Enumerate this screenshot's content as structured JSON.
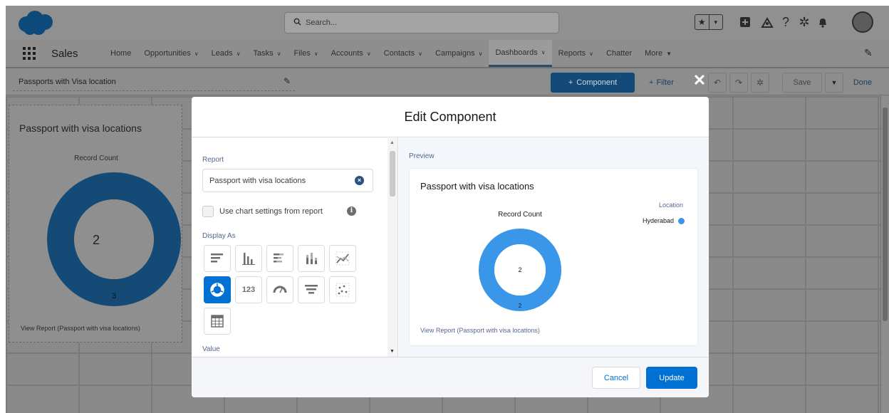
{
  "colors": {
    "brand": "#0070d2",
    "donut": "#3a96e8",
    "overlay_donut": "#164a76",
    "legend_dot": "#3a96e8"
  },
  "header": {
    "search_placeholder": "Search...",
    "icons": [
      "favorites-star-icon",
      "favorites-list-icon",
      "global-actions-icon",
      "trailhead-icon",
      "help-icon",
      "setup-gear-icon",
      "notifications-bell-icon"
    ]
  },
  "nav": {
    "app_name": "Sales",
    "items": [
      {
        "label": "Home",
        "chevron": false
      },
      {
        "label": "Opportunities",
        "chevron": true
      },
      {
        "label": "Leads",
        "chevron": true
      },
      {
        "label": "Tasks",
        "chevron": true
      },
      {
        "label": "Files",
        "chevron": true
      },
      {
        "label": "Accounts",
        "chevron": true
      },
      {
        "label": "Contacts",
        "chevron": true
      },
      {
        "label": "Campaigns",
        "chevron": true
      },
      {
        "label": "Dashboards",
        "chevron": true,
        "active": true
      },
      {
        "label": "Reports",
        "chevron": true
      },
      {
        "label": "Chatter",
        "chevron": false
      },
      {
        "label": "More",
        "chevron": true
      }
    ]
  },
  "toolbar": {
    "dashboard_title": "Passports with Visa location",
    "component_label": "Component",
    "filter_label": "Filter",
    "save_label": "Save",
    "done_label": "Done"
  },
  "background_widget": {
    "title": "Passport with visa locations",
    "record_count_label": "Record Count",
    "center_value": "2",
    "segment_value": "3",
    "view_report_link": "View Report (Passport with visa locations)"
  },
  "modal": {
    "title": "Edit Component",
    "report_label": "Report",
    "report_value": "Passport with visa locations",
    "use_chart_settings_label": "Use chart settings from report",
    "use_chart_settings_checked": false,
    "display_as_label": "Display As",
    "chart_types": [
      {
        "icon": "horizontal-bar-icon",
        "active": false
      },
      {
        "icon": "vertical-bar-icon",
        "active": false
      },
      {
        "icon": "stacked-horizontal-bar-icon",
        "active": false
      },
      {
        "icon": "stacked-vertical-bar-icon",
        "active": false
      },
      {
        "icon": "line-chart-icon",
        "active": false
      },
      {
        "icon": "donut-icon",
        "active": true
      },
      {
        "icon": "metric-icon",
        "label": "123",
        "active": false
      },
      {
        "icon": "gauge-icon",
        "active": false
      },
      {
        "icon": "funnel-icon",
        "active": false
      },
      {
        "icon": "scatter-icon",
        "active": false
      },
      {
        "icon": "table-icon",
        "active": false
      }
    ],
    "value_label": "Value",
    "preview_label": "Preview",
    "preview": {
      "title": "Passport with visa locations",
      "record_count_label": "Record Count",
      "legend_title": "Location",
      "legend_item": "Hyderabad",
      "center_value": "2",
      "segment_value": "2",
      "view_report_link": "View Report (Passport with visa locations)"
    },
    "cancel_label": "Cancel",
    "update_label": "Update"
  }
}
